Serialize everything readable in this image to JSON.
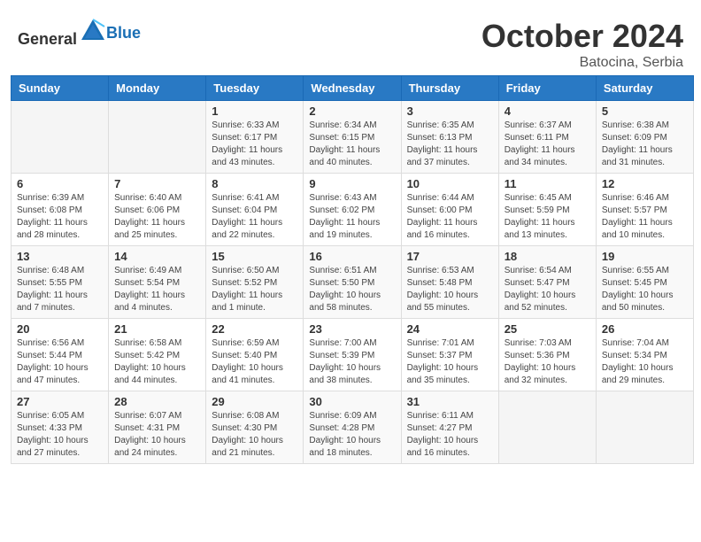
{
  "header": {
    "logo_general": "General",
    "logo_blue": "Blue",
    "month": "October 2024",
    "location": "Batocina, Serbia"
  },
  "weekdays": [
    "Sunday",
    "Monday",
    "Tuesday",
    "Wednesday",
    "Thursday",
    "Friday",
    "Saturday"
  ],
  "weeks": [
    [
      {
        "day": "",
        "info": ""
      },
      {
        "day": "",
        "info": ""
      },
      {
        "day": "1",
        "info": "Sunrise: 6:33 AM\nSunset: 6:17 PM\nDaylight: 11 hours and 43 minutes."
      },
      {
        "day": "2",
        "info": "Sunrise: 6:34 AM\nSunset: 6:15 PM\nDaylight: 11 hours and 40 minutes."
      },
      {
        "day": "3",
        "info": "Sunrise: 6:35 AM\nSunset: 6:13 PM\nDaylight: 11 hours and 37 minutes."
      },
      {
        "day": "4",
        "info": "Sunrise: 6:37 AM\nSunset: 6:11 PM\nDaylight: 11 hours and 34 minutes."
      },
      {
        "day": "5",
        "info": "Sunrise: 6:38 AM\nSunset: 6:09 PM\nDaylight: 11 hours and 31 minutes."
      }
    ],
    [
      {
        "day": "6",
        "info": "Sunrise: 6:39 AM\nSunset: 6:08 PM\nDaylight: 11 hours and 28 minutes."
      },
      {
        "day": "7",
        "info": "Sunrise: 6:40 AM\nSunset: 6:06 PM\nDaylight: 11 hours and 25 minutes."
      },
      {
        "day": "8",
        "info": "Sunrise: 6:41 AM\nSunset: 6:04 PM\nDaylight: 11 hours and 22 minutes."
      },
      {
        "day": "9",
        "info": "Sunrise: 6:43 AM\nSunset: 6:02 PM\nDaylight: 11 hours and 19 minutes."
      },
      {
        "day": "10",
        "info": "Sunrise: 6:44 AM\nSunset: 6:00 PM\nDaylight: 11 hours and 16 minutes."
      },
      {
        "day": "11",
        "info": "Sunrise: 6:45 AM\nSunset: 5:59 PM\nDaylight: 11 hours and 13 minutes."
      },
      {
        "day": "12",
        "info": "Sunrise: 6:46 AM\nSunset: 5:57 PM\nDaylight: 11 hours and 10 minutes."
      }
    ],
    [
      {
        "day": "13",
        "info": "Sunrise: 6:48 AM\nSunset: 5:55 PM\nDaylight: 11 hours and 7 minutes."
      },
      {
        "day": "14",
        "info": "Sunrise: 6:49 AM\nSunset: 5:54 PM\nDaylight: 11 hours and 4 minutes."
      },
      {
        "day": "15",
        "info": "Sunrise: 6:50 AM\nSunset: 5:52 PM\nDaylight: 11 hours and 1 minute."
      },
      {
        "day": "16",
        "info": "Sunrise: 6:51 AM\nSunset: 5:50 PM\nDaylight: 10 hours and 58 minutes."
      },
      {
        "day": "17",
        "info": "Sunrise: 6:53 AM\nSunset: 5:48 PM\nDaylight: 10 hours and 55 minutes."
      },
      {
        "day": "18",
        "info": "Sunrise: 6:54 AM\nSunset: 5:47 PM\nDaylight: 10 hours and 52 minutes."
      },
      {
        "day": "19",
        "info": "Sunrise: 6:55 AM\nSunset: 5:45 PM\nDaylight: 10 hours and 50 minutes."
      }
    ],
    [
      {
        "day": "20",
        "info": "Sunrise: 6:56 AM\nSunset: 5:44 PM\nDaylight: 10 hours and 47 minutes."
      },
      {
        "day": "21",
        "info": "Sunrise: 6:58 AM\nSunset: 5:42 PM\nDaylight: 10 hours and 44 minutes."
      },
      {
        "day": "22",
        "info": "Sunrise: 6:59 AM\nSunset: 5:40 PM\nDaylight: 10 hours and 41 minutes."
      },
      {
        "day": "23",
        "info": "Sunrise: 7:00 AM\nSunset: 5:39 PM\nDaylight: 10 hours and 38 minutes."
      },
      {
        "day": "24",
        "info": "Sunrise: 7:01 AM\nSunset: 5:37 PM\nDaylight: 10 hours and 35 minutes."
      },
      {
        "day": "25",
        "info": "Sunrise: 7:03 AM\nSunset: 5:36 PM\nDaylight: 10 hours and 32 minutes."
      },
      {
        "day": "26",
        "info": "Sunrise: 7:04 AM\nSunset: 5:34 PM\nDaylight: 10 hours and 29 minutes."
      }
    ],
    [
      {
        "day": "27",
        "info": "Sunrise: 6:05 AM\nSunset: 4:33 PM\nDaylight: 10 hours and 27 minutes."
      },
      {
        "day": "28",
        "info": "Sunrise: 6:07 AM\nSunset: 4:31 PM\nDaylight: 10 hours and 24 minutes."
      },
      {
        "day": "29",
        "info": "Sunrise: 6:08 AM\nSunset: 4:30 PM\nDaylight: 10 hours and 21 minutes."
      },
      {
        "day": "30",
        "info": "Sunrise: 6:09 AM\nSunset: 4:28 PM\nDaylight: 10 hours and 18 minutes."
      },
      {
        "day": "31",
        "info": "Sunrise: 6:11 AM\nSunset: 4:27 PM\nDaylight: 10 hours and 16 minutes."
      },
      {
        "day": "",
        "info": ""
      },
      {
        "day": "",
        "info": ""
      }
    ]
  ]
}
